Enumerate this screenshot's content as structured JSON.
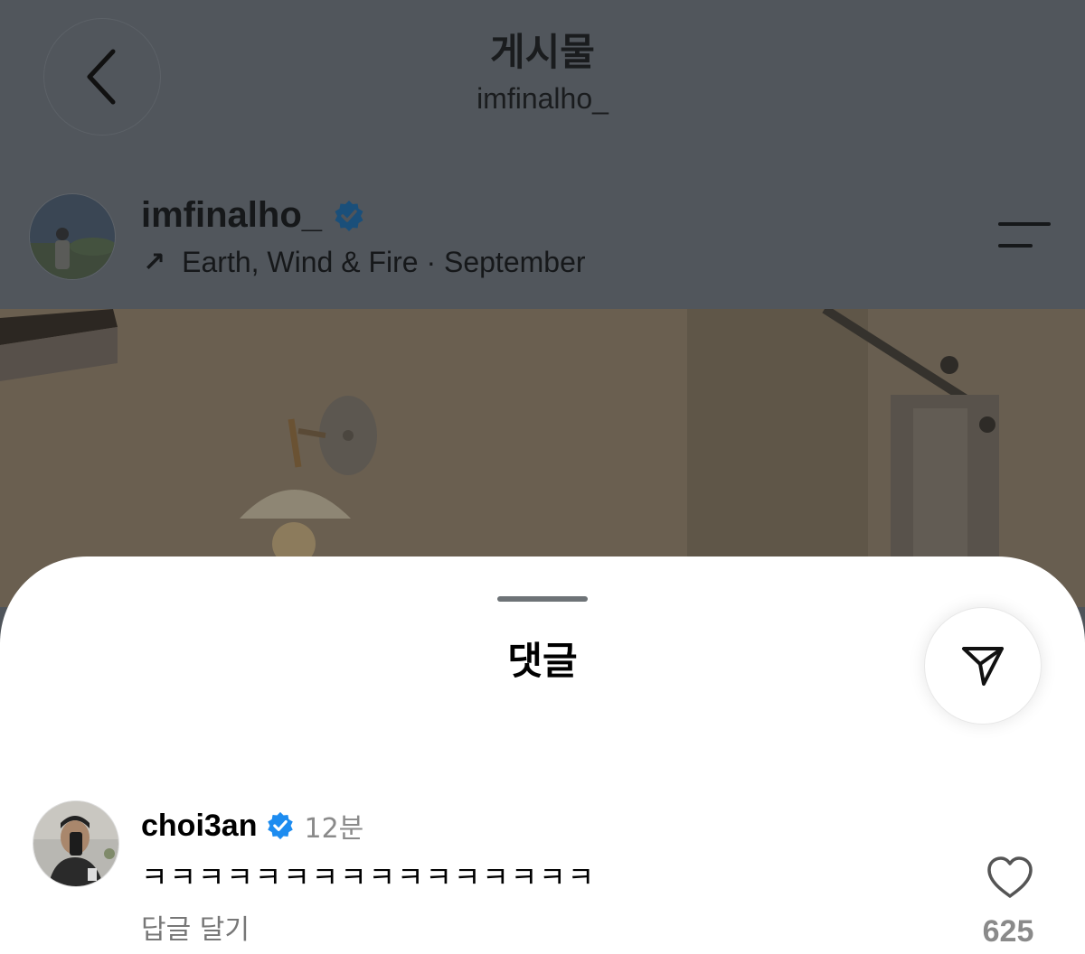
{
  "header": {
    "title": "게시물",
    "subtitle": "imfinalho_",
    "back_icon": "chevron-left-icon"
  },
  "post": {
    "username": "imfinalho_",
    "verified": true,
    "music": "Earth, Wind & Fire · September",
    "music_icon": "arrow-up-right-icon",
    "menu_icon": "menu-icon"
  },
  "comments_sheet": {
    "title": "댓글",
    "share_icon": "send-icon",
    "comments": [
      {
        "username": "choi3an",
        "verified": true,
        "time": "12분",
        "text": "ㅋㅋㅋㅋㅋㅋㅋㅋㅋㅋㅋㅋㅋㅋㅋㅋ",
        "reply_label": "답글 달기",
        "like_icon": "heart-icon",
        "like_count": "625"
      }
    ]
  },
  "colors": {
    "overlay_bg": "#51565c",
    "verified_badge": "#1d8cf0",
    "sheet_bg": "#ffffff",
    "muted_text": "#8a8a8a"
  }
}
